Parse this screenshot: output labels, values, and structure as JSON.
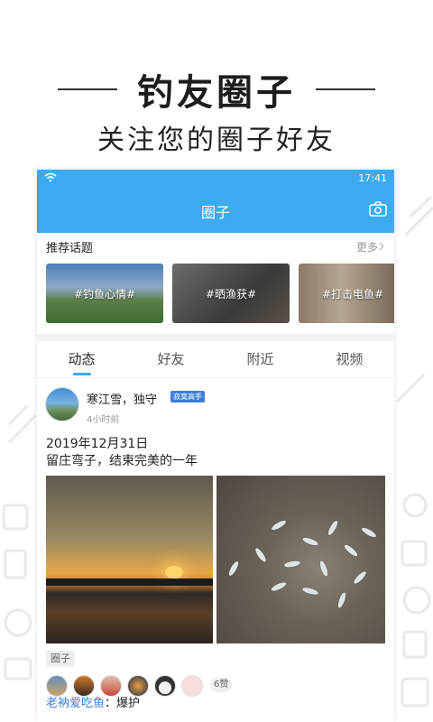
{
  "promo": {
    "title": "钓友圈子",
    "subtitle": "关注您的圈子好友"
  },
  "statusbar": {
    "time": "17:41"
  },
  "titlebar": {
    "title": "圈子"
  },
  "topics": {
    "header": "推荐话题",
    "more": "更多",
    "items": [
      {
        "label": "#钓鱼心情#"
      },
      {
        "label": "#晒渔获#"
      },
      {
        "label": "#打击电鱼#"
      }
    ]
  },
  "tabs": [
    {
      "label": "动态"
    },
    {
      "label": "好友"
    },
    {
      "label": "附近"
    },
    {
      "label": "视频"
    }
  ],
  "post": {
    "user": "寒江雪，独守",
    "badge": "寂寞高手",
    "time": "4小时前",
    "text_line1": "2019年12月31日",
    "text_line2": "留庄弯子，结束完美的一年",
    "tag": "圈子",
    "likes": "6赞",
    "comments": [
      {
        "user": "老衲爱吃鱼",
        "text": "：爆护"
      }
    ]
  },
  "colors": {
    "accent": "#3daaf0",
    "link": "#3d7fd6"
  }
}
